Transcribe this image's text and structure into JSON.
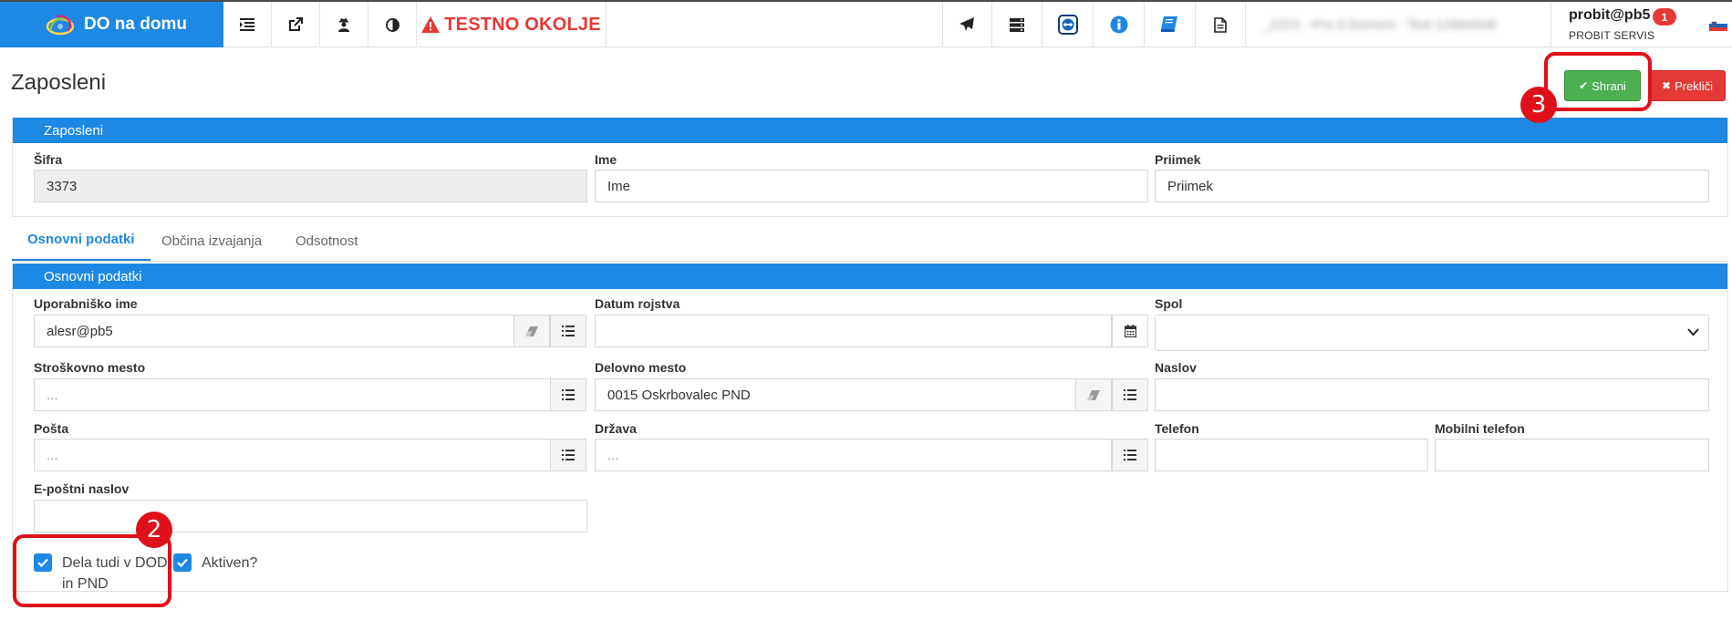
{
  "app": {
    "brand": "DO na domu",
    "environment_label": "TESTNO OKOLJE",
    "company_name_blurred": "_DZO - Pro d Domovi - Test 12894508",
    "user_name": "probit@pb5",
    "user_org": "PROBIT SERVIS",
    "notification_count": "1"
  },
  "page": {
    "title": "Zaposleni",
    "save_label": "Shrani",
    "cancel_label": "Prekliči"
  },
  "header_panel": {
    "title": "Zaposleni",
    "fields": {
      "sifra_label": "Šifra",
      "sifra_value": "3373",
      "ime_label": "Ime",
      "ime_value": "Ime",
      "priimek_label": "Priimek",
      "priimek_value": "Priimek"
    }
  },
  "tabs": [
    {
      "label": "Osnovni podatki",
      "active": true
    },
    {
      "label": "Občina izvajanja",
      "active": false
    },
    {
      "label": "Odsotnost",
      "active": false
    }
  ],
  "basic_panel": {
    "title": "Osnovni podatki",
    "username_label": "Uporabniško ime",
    "username_value": "alesr@pb5",
    "birth_date_label": "Datum rojstva",
    "birth_date_value": "",
    "gender_label": "Spol",
    "gender_value": "",
    "cost_center_label": "Stroškovno mesto",
    "cost_center_placeholder": "...",
    "workplace_label": "Delovno mesto",
    "workplace_value": "0015 Oskrbovalec PND",
    "address_label": "Naslov",
    "address_value": "",
    "post_label": "Pošta",
    "post_placeholder": "...",
    "country_label": "Država",
    "country_placeholder": "...",
    "phone_label": "Telefon",
    "phone_value": "",
    "mobile_label": "Mobilni telefon",
    "mobile_value": "",
    "email_label": "E-poštni naslov",
    "email_value": "",
    "works_in_dod_line1": "Dela tudi v DOD",
    "works_in_dod_line2": "in PND",
    "works_in_dod_checked": true,
    "active_label": "Aktiven?",
    "active_checked": true
  },
  "annotations": {
    "marker_2": "2",
    "marker_3": "3"
  },
  "colors": {
    "primary": "#1e88e5",
    "success": "#4caf50",
    "danger": "#e53935",
    "annotation": "#e0101a"
  }
}
